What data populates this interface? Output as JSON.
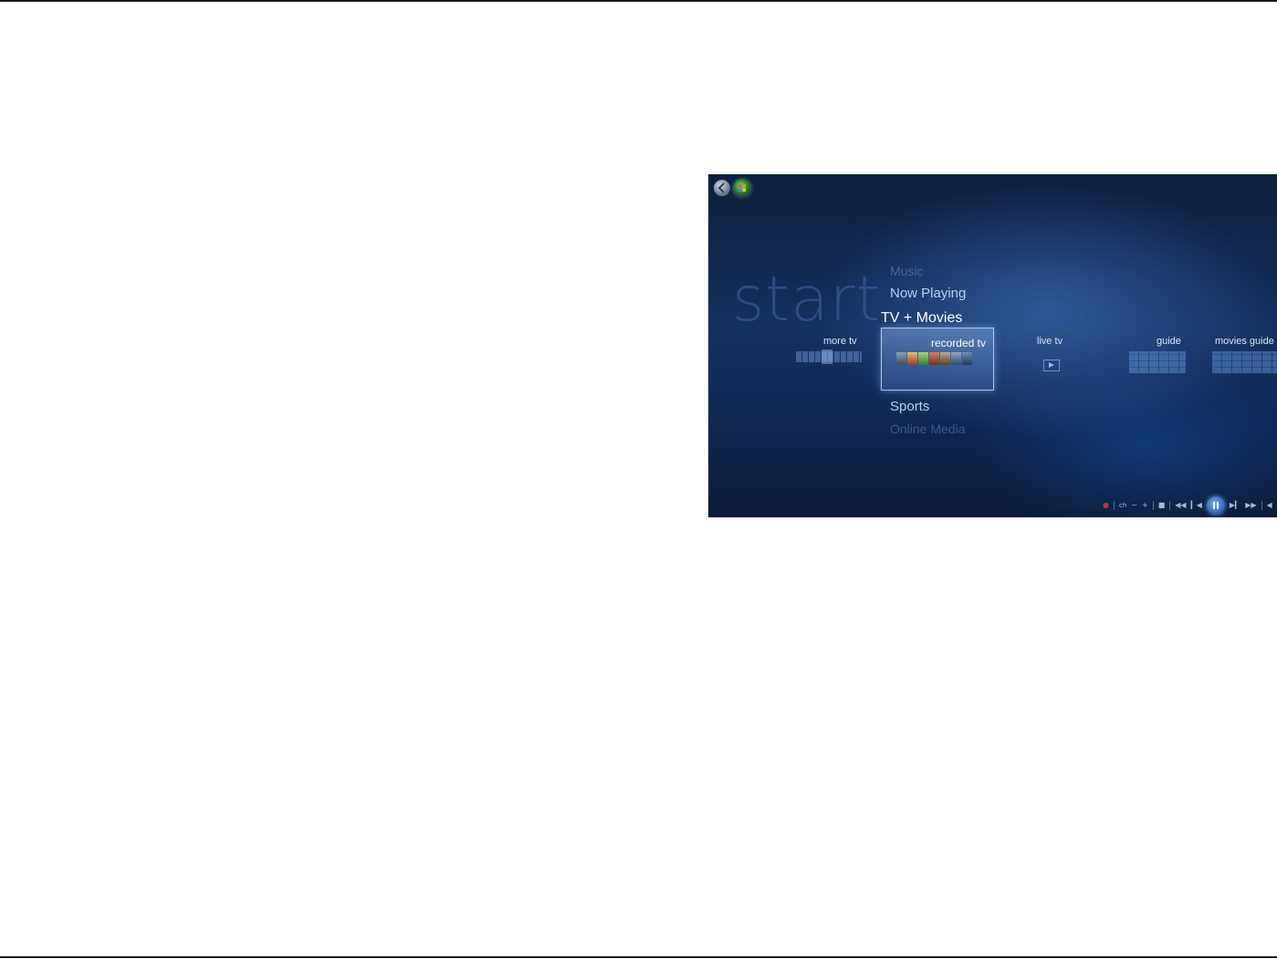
{
  "window": {
    "title": ""
  },
  "start": {
    "label": "start"
  },
  "menu": {
    "music": "Music",
    "now_playing": "Now Playing",
    "tv_movies": "TV + Movies",
    "sports": "Sports",
    "online_media": "Online Media"
  },
  "strip": {
    "more_tv": "more tv",
    "recorded_tv": "recorded tv",
    "live_tv": "live tv",
    "guide": "guide",
    "movies_guide": "movies guide"
  },
  "transport": {
    "ch_label": "ch",
    "minus_label": "−",
    "plus_label": "+",
    "stop_label": "■",
    "rewind_label": "◀◀",
    "prev_label": "▎◀",
    "next_label": "▶▎",
    "ffwd_label": "▶▶",
    "volume_label": "◀"
  },
  "icons": {
    "back": "back-orb-icon",
    "windows": "windows-orb-icon",
    "record": "record-icon",
    "pause": "pause-icon",
    "live_tv": "play-icon"
  },
  "colors": {
    "background": "#0d2750",
    "focus_border": "#c8dcf5",
    "record": "#c03030",
    "accent": "#2a5fb0"
  }
}
